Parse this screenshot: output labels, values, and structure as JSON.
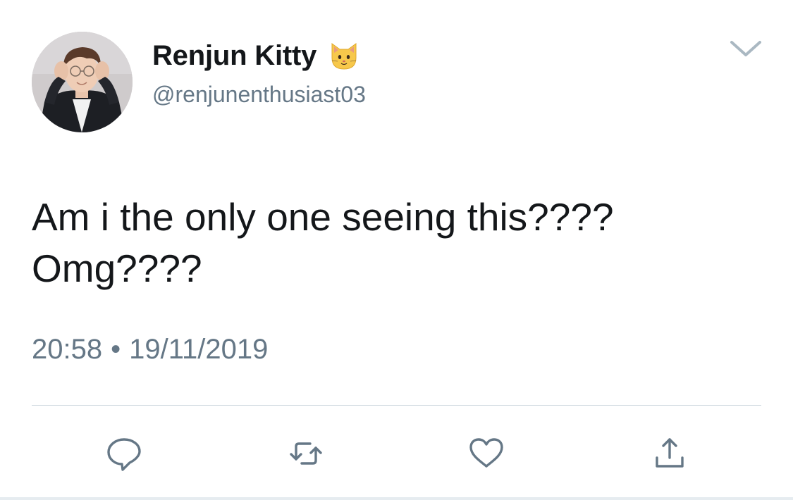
{
  "author": {
    "display_name": "Renjun Kitty",
    "name_emoji": "cat-face-emoji",
    "handle": "@renjunenthusiast03",
    "avatar": "profile-photo"
  },
  "tweet": {
    "lines": [
      "Am i the only one seeing this????",
      "Omg????"
    ]
  },
  "meta": {
    "time": "20:58",
    "separator": "•",
    "date": "19/11/2019"
  },
  "actions": [
    {
      "icon": "reply-icon"
    },
    {
      "icon": "retweet-icon"
    },
    {
      "icon": "like-icon"
    },
    {
      "icon": "share-icon"
    }
  ],
  "colors": {
    "text": "#14171a",
    "secondary": "#657786",
    "icon": "#657786",
    "divider": "#ccd6dd"
  }
}
